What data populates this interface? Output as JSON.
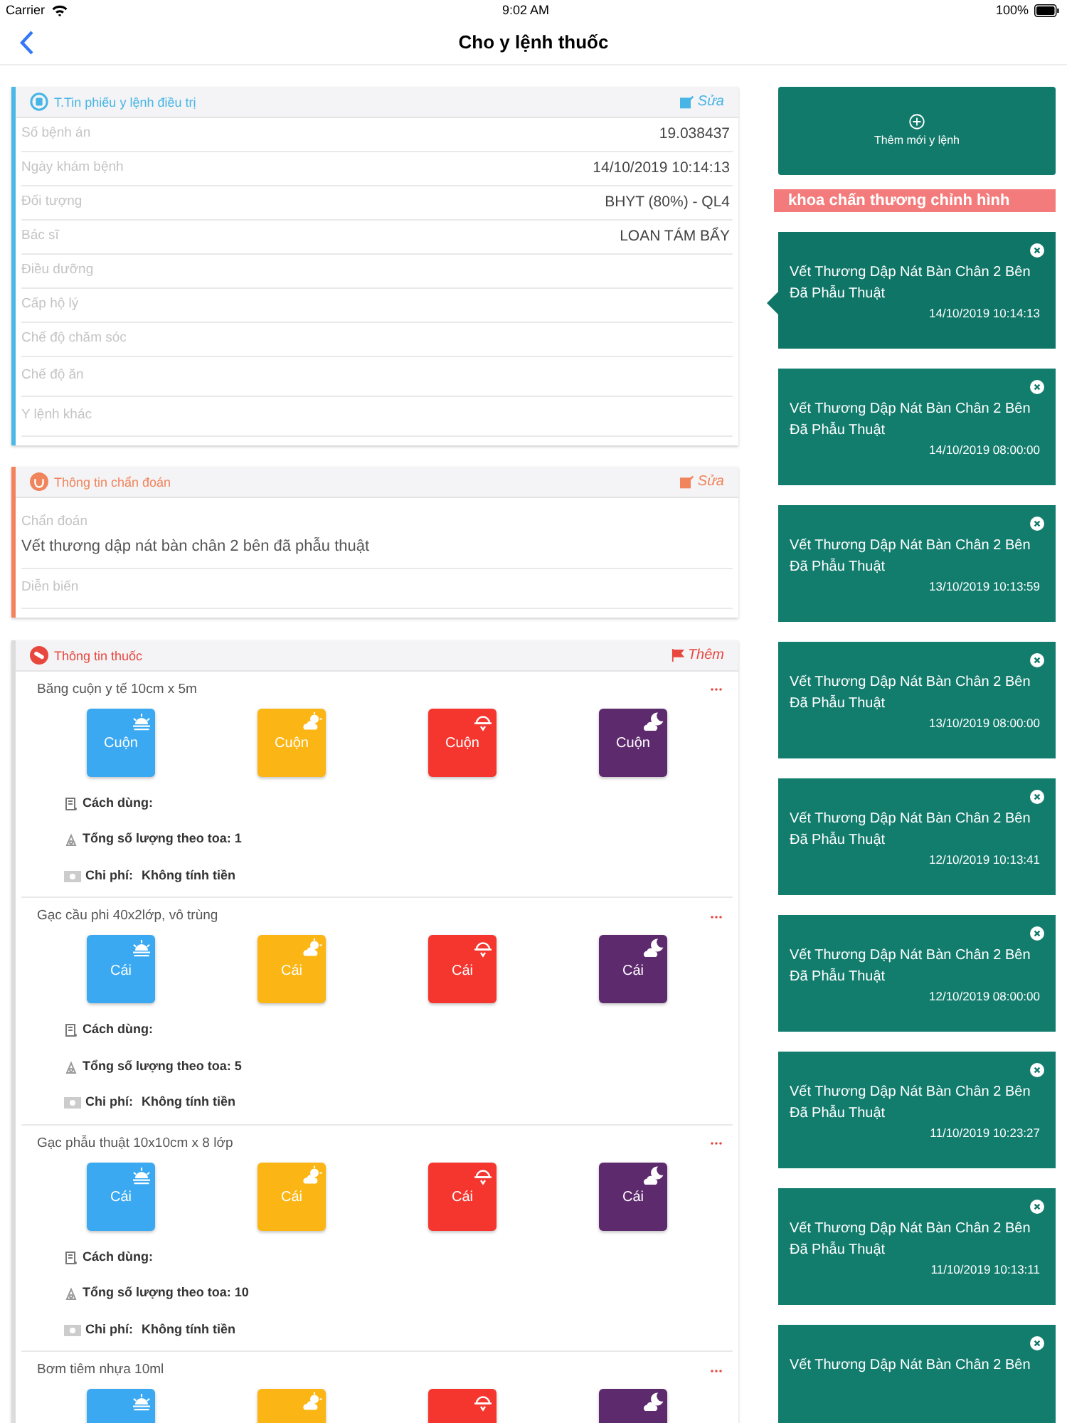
{
  "status_bar": {
    "carrier": "Carrier",
    "time": "9:02 AM",
    "battery": "100%"
  },
  "nav": {
    "title": "Cho y lệnh thuốc"
  },
  "info_section": {
    "title": "T.Tin phiếu y lệnh điều trị",
    "action": "Sửa",
    "rows": [
      {
        "label": "Số bệnh án",
        "value": "19.038437"
      },
      {
        "label": "Ngày khám bệnh",
        "value": "14/10/2019 10:14:13"
      },
      {
        "label": "Đối tượng",
        "value": "BHYT (80%) - QL4"
      },
      {
        "label": "Bác sĩ",
        "value": "LOAN TÁM BẨY"
      },
      {
        "label": "Điều dưỡng"
      },
      {
        "label": "Cấp hộ lý"
      },
      {
        "label": "Chế độ chăm sóc"
      },
      {
        "label": "Chế độ ăn"
      },
      {
        "label": "Y lệnh khác"
      }
    ]
  },
  "diagnosis_section": {
    "title": "Thông tin chẩn đoán",
    "action": "Sửa",
    "diagnosis_label": "Chẩn đoán",
    "diagnosis": "Vết thương dập nát bàn chân 2 bên đã phẫu thuật",
    "progress_label": "Diễn biến"
  },
  "drug_section": {
    "title": "Thông tin thuốc",
    "action": "Thêm",
    "items": [
      {
        "name": "Băng cuộn y tế 10cm x 5m",
        "doses": [
          {
            "kind": "morning",
            "unit": "Cuộn"
          },
          {
            "kind": "noon",
            "unit": "Cuộn"
          },
          {
            "kind": "afternoon",
            "unit": "Cuộn"
          },
          {
            "kind": "evening",
            "unit": "Cuộn"
          }
        ],
        "usage_label": "Cách dùng:",
        "total": "Tổng số lượng theo toa: 1",
        "cost_label": "Chi phí:",
        "cost": "Không tính tiền"
      },
      {
        "name": "Gạc cầu phi 40x2lớp, vô trùng",
        "doses": [
          {
            "kind": "morning",
            "unit": "Cái"
          },
          {
            "kind": "noon",
            "unit": "Cái"
          },
          {
            "kind": "afternoon",
            "unit": "Cái"
          },
          {
            "kind": "evening",
            "unit": "Cái"
          }
        ],
        "usage_label": "Cách dùng:",
        "total": "Tổng số lượng theo toa: 5",
        "cost_label": "Chi phí:",
        "cost": "Không tính tiền"
      },
      {
        "name": "Gạc phẫu thuật 10x10cm x 8 lớp",
        "doses": [
          {
            "kind": "morning",
            "unit": "Cái"
          },
          {
            "kind": "noon",
            "unit": "Cái"
          },
          {
            "kind": "afternoon",
            "unit": "Cái"
          },
          {
            "kind": "evening",
            "unit": "Cái"
          }
        ],
        "usage_label": "Cách dùng:",
        "total": "Tổng số lượng theo toa: 10",
        "cost_label": "Chi phí:",
        "cost": "Không tính tiền"
      },
      {
        "name": "Bơm tiêm nhựa 10ml",
        "doses": [
          {
            "kind": "morning"
          },
          {
            "kind": "noon"
          },
          {
            "kind": "afternoon"
          },
          {
            "kind": "evening"
          }
        ]
      }
    ]
  },
  "add_order": {
    "label": "Thêm mới y lệnh"
  },
  "department": "khoa chấn thương chỉnh hình",
  "orders": [
    {
      "title": "Vết Thương Dập Nát Bàn Chân 2 Bên Đã Phẫu Thuật",
      "time": "14/10/2019 10:14:13",
      "selected": true
    },
    {
      "title": "Vết Thương Dập Nát Bàn Chân 2 Bên Đã Phẫu Thuật",
      "time": "14/10/2019 08:00:00",
      "selected": false
    },
    {
      "title": "Vết Thương Dập Nát Bàn Chân 2 Bên Đã Phẫu Thuật",
      "time": "13/10/2019 10:13:59",
      "selected": false
    },
    {
      "title": "Vết Thương Dập Nát Bàn Chân 2 Bên Đã Phẫu Thuật",
      "time": "13/10/2019 08:00:00",
      "selected": false
    },
    {
      "title": "Vết Thương Dập Nát Bàn Chân 2 Bên Đã Phẫu Thuật",
      "time": "12/10/2019 10:13:41",
      "selected": false
    },
    {
      "title": "Vết Thương Dập Nát Bàn Chân 2 Bên Đã Phẫu Thuật",
      "time": "12/10/2019 08:00:00",
      "selected": false
    },
    {
      "title": "Vết Thương Dập Nát Bàn Chân 2 Bên Đã Phẫu Thuật",
      "time": "11/10/2019 10:23:27",
      "selected": false
    },
    {
      "title": "Vết Thương Dập Nát Bàn Chân 2 Bên Đã Phẫu Thuật",
      "time": "11/10/2019 10:13:11",
      "selected": false
    },
    {
      "title": "Vết Thương Dập Nát Bàn Chân 2 Bên",
      "selected": false
    }
  ]
}
